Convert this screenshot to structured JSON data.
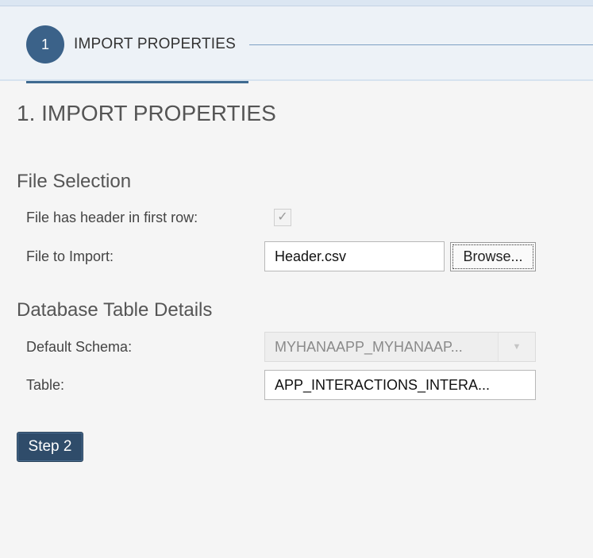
{
  "wizard": {
    "step_number": "1",
    "step_title": "IMPORT PROPERTIES"
  },
  "page": {
    "title": "1. IMPORT PROPERTIES"
  },
  "file_selection": {
    "section_title": "File Selection",
    "header_label": "File has header in first row:",
    "header_checked": true,
    "file_label": "File to Import:",
    "file_value": "Header.csv",
    "browse_label": "Browse..."
  },
  "db_table": {
    "section_title": "Database Table Details",
    "schema_label": "Default Schema:",
    "schema_value": "MYHANAAPP_MYHANAAP...",
    "table_label": "Table:",
    "table_value": "APP_INTERACTIONS_INTERA..."
  },
  "actions": {
    "next_label": "Step 2"
  },
  "colors": {
    "accent": "#3b6289",
    "primary_button": "#2f4c6a"
  },
  "icons": {
    "checkbox": "check-icon",
    "select": "chevron-down-icon"
  }
}
